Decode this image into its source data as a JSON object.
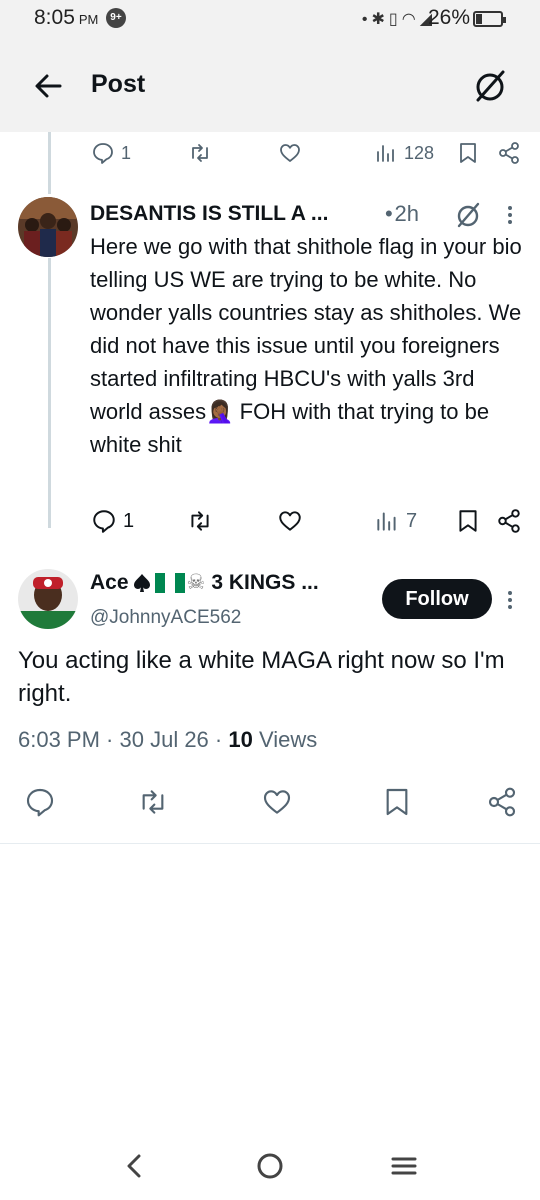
{
  "status_bar": {
    "time": "8:05",
    "ampm": "PM",
    "notification_badge": "9+",
    "battery_percent": "26%",
    "battery_level": 0.26,
    "icons": [
      "dot-icon",
      "bluetooth-icon",
      "vibrate-icon",
      "wifi-icon",
      "signal-icon"
    ]
  },
  "header": {
    "title": "Post",
    "back_icon": "arrow-left-icon",
    "grok_icon": "grok-icon"
  },
  "parent_tweet_actions": {
    "replies": "1",
    "reposts": "",
    "likes": "",
    "views": "128"
  },
  "reply_tweet": {
    "display_name": "DESANTIS IS STILL A ...",
    "time": "2h",
    "text": "Here we go with that shithole flag in your bio telling US WE are trying to be white. No wonder yalls countries stay as shitholes. We did not have this issue until you foreigners started infiltrating HBCU's with yalls 3rd world asses🤦🏾‍♀️ FOH with that trying to be white shit",
    "actions": {
      "replies": "1",
      "reposts": "",
      "likes": "",
      "views": "7"
    }
  },
  "main_tweet": {
    "display_name_prefix": "Ace",
    "display_name_suffix": "3 KINGS ...",
    "handle": "@JohnnyACE562",
    "follow_label": "Follow",
    "text": "You acting like a white MAGA right now so I'm right.",
    "time": "6:03 PM",
    "date": "30 Jul 26",
    "views_count": "10",
    "views_label": "Views"
  },
  "colors": {
    "text_primary": "#0f1419",
    "text_secondary": "#536471",
    "header_bg": "#f2f2f2",
    "follow_bg": "#0f1419",
    "thread_line": "#cfd9de"
  }
}
